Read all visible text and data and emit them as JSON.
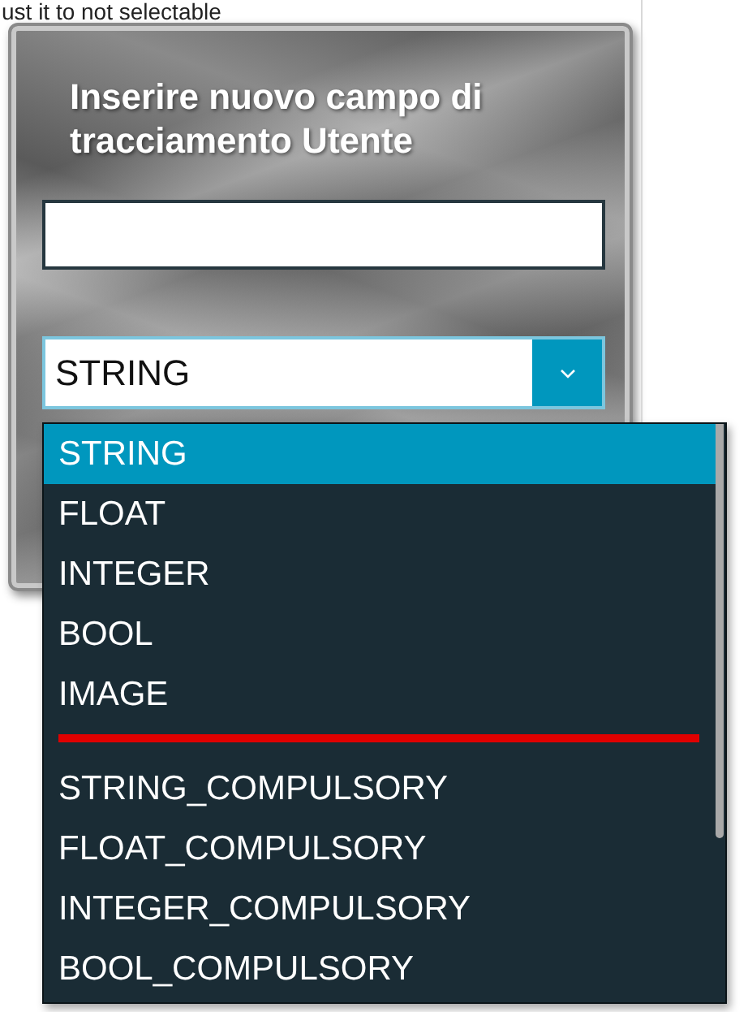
{
  "background_text": "ust it to not selectable",
  "dialog": {
    "title": "Inserire nuovo campo di tracciamento Utente",
    "type_combo": {
      "value": "STRING",
      "expanded": true
    },
    "options": [
      {
        "kind": "option",
        "label": "STRING",
        "selected": true
      },
      {
        "kind": "option",
        "label": "FLOAT",
        "selected": false
      },
      {
        "kind": "option",
        "label": "INTEGER",
        "selected": false
      },
      {
        "kind": "option",
        "label": "BOOL",
        "selected": false
      },
      {
        "kind": "option",
        "label": "IMAGE",
        "selected": false
      },
      {
        "kind": "separator"
      },
      {
        "kind": "option",
        "label": "STRING_COMPULSORY",
        "selected": false
      },
      {
        "kind": "option",
        "label": "FLOAT_COMPULSORY",
        "selected": false
      },
      {
        "kind": "option",
        "label": "INTEGER_COMPULSORY",
        "selected": false
      },
      {
        "kind": "option",
        "label": "BOOL_COMPULSORY",
        "selected": false
      }
    ]
  }
}
